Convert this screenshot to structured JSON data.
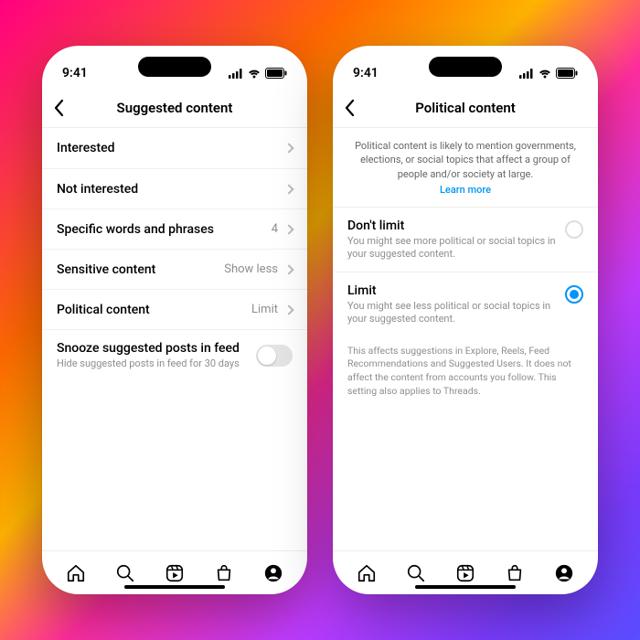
{
  "status": {
    "time": "9:41"
  },
  "phone1": {
    "header": {
      "title": "Suggested content"
    },
    "rows": {
      "interested": {
        "label": "Interested"
      },
      "not_interested": {
        "label": "Not interested"
      },
      "words": {
        "label": "Specific words and phrases",
        "value": "4"
      },
      "sensitive": {
        "label": "Sensitive content",
        "value": "Show less"
      },
      "political": {
        "label": "Political content",
        "value": "Limit"
      },
      "snooze": {
        "label": "Snooze suggested posts in feed",
        "sub": "Hide suggested posts in feed for 30 days"
      }
    }
  },
  "phone2": {
    "header": {
      "title": "Political content"
    },
    "description": "Political content is likely to mention governments, elections, or social topics that affect a group of people and/or society at large.",
    "learn_more": "Learn more",
    "options": {
      "dont_limit": {
        "label": "Don't limit",
        "sub": "You might see more political or social topics in your suggested content."
      },
      "limit": {
        "label": "Limit",
        "sub": "You might see less political or social topics in your suggested content."
      }
    },
    "footnote": "This affects suggestions in Explore, Reels, Feed Recommendations and Suggested Users. It does not affect the content from accounts you follow. This setting also applies to Threads."
  }
}
